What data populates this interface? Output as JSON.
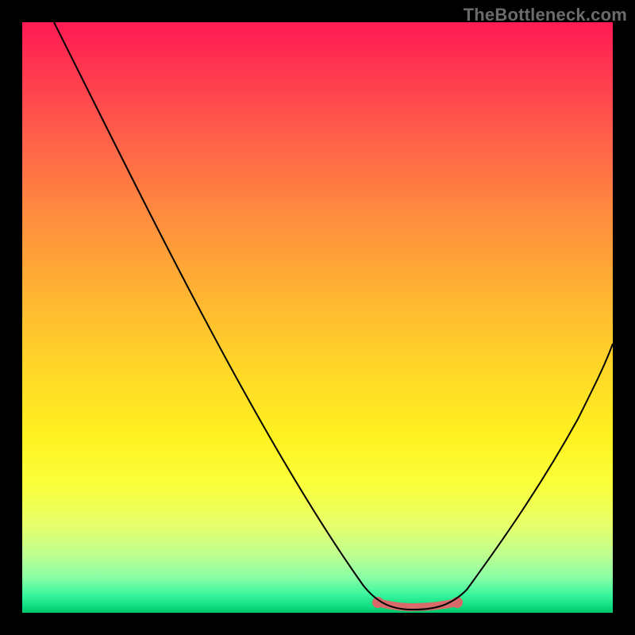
{
  "watermark": "TheBottleneck.com",
  "colors": {
    "background": "#000000",
    "curve": "#000000",
    "highlight": "#d86a6a"
  },
  "chart_data": {
    "type": "line",
    "title": "",
    "xlabel": "",
    "ylabel": "",
    "xlim": [
      0,
      100
    ],
    "ylim": [
      0,
      100
    ],
    "series": [
      {
        "name": "bottleneck-curve",
        "x": [
          5,
          10,
          15,
          20,
          25,
          30,
          35,
          40,
          45,
          50,
          55,
          58,
          62,
          66,
          70,
          73,
          76,
          80,
          85,
          90,
          95,
          100
        ],
        "y": [
          100,
          93,
          85,
          77,
          69,
          61,
          53,
          45,
          37,
          29,
          20,
          13,
          6,
          2,
          1,
          1,
          2,
          6,
          15,
          27,
          40,
          55
        ]
      }
    ],
    "highlight_range": {
      "x_start": 60,
      "x_end": 78,
      "y": 1
    },
    "grid": false,
    "legend": false
  }
}
